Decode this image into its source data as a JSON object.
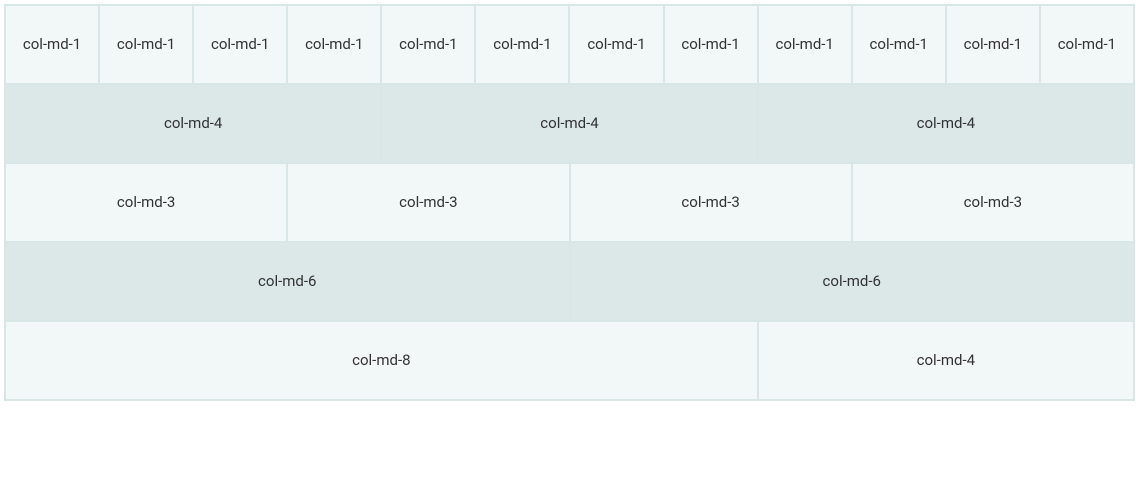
{
  "rows": [
    {
      "variant": "odd",
      "cols": [
        {
          "width": 1,
          "label": "col-md-1"
        },
        {
          "width": 1,
          "label": "col-md-1"
        },
        {
          "width": 1,
          "label": "col-md-1"
        },
        {
          "width": 1,
          "label": "col-md-1"
        },
        {
          "width": 1,
          "label": "col-md-1"
        },
        {
          "width": 1,
          "label": "col-md-1"
        },
        {
          "width": 1,
          "label": "col-md-1"
        },
        {
          "width": 1,
          "label": "col-md-1"
        },
        {
          "width": 1,
          "label": "col-md-1"
        },
        {
          "width": 1,
          "label": "col-md-1"
        },
        {
          "width": 1,
          "label": "col-md-1"
        },
        {
          "width": 1,
          "label": "col-md-1"
        }
      ]
    },
    {
      "variant": "even",
      "cols": [
        {
          "width": 4,
          "label": "col-md-4"
        },
        {
          "width": 4,
          "label": "col-md-4"
        },
        {
          "width": 4,
          "label": "col-md-4"
        }
      ]
    },
    {
      "variant": "odd",
      "cols": [
        {
          "width": 3,
          "label": "col-md-3"
        },
        {
          "width": 3,
          "label": "col-md-3"
        },
        {
          "width": 3,
          "label": "col-md-3"
        },
        {
          "width": 3,
          "label": "col-md-3"
        }
      ]
    },
    {
      "variant": "even",
      "cols": [
        {
          "width": 6,
          "label": "col-md-6"
        },
        {
          "width": 6,
          "label": "col-md-6"
        }
      ]
    },
    {
      "variant": "odd",
      "cols": [
        {
          "width": 8,
          "label": "col-md-8"
        },
        {
          "width": 4,
          "label": "col-md-4"
        }
      ]
    }
  ]
}
